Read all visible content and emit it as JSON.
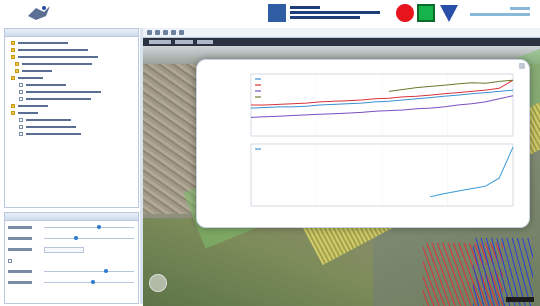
{
  "app": {
    "title": ""
  },
  "colors": {
    "alert": "#e8141d",
    "ok": "#16b34a",
    "info": "#2a4fa8",
    "accent": "#2f7dd2"
  },
  "banner": {
    "logo_icon": "satellite-logo-icon",
    "status_icons": [
      "red-circle-icon",
      "green-square-icon",
      "blue-triangle-down-icon"
    ]
  },
  "layers": {
    "header": "",
    "items": [
      {
        "type": "folder",
        "label": ""
      },
      {
        "type": "folder",
        "label": ""
      },
      {
        "type": "folder",
        "label": ""
      },
      {
        "type": "folder",
        "label": ""
      },
      {
        "type": "folder",
        "label": ""
      },
      {
        "type": "folder",
        "label": ""
      },
      {
        "type": "checkbox",
        "label": ""
      },
      {
        "type": "checkbox",
        "label": ""
      },
      {
        "type": "checkbox",
        "label": ""
      },
      {
        "type": "folder",
        "label": ""
      },
      {
        "type": "folder",
        "label": ""
      },
      {
        "type": "checkbox",
        "label": ""
      },
      {
        "type": "checkbox",
        "label": ""
      },
      {
        "type": "checkbox",
        "label": ""
      }
    ]
  },
  "properties": {
    "header": "",
    "rows": [
      {
        "kind": "slider",
        "label": "",
        "value": 0.62
      },
      {
        "kind": "slider",
        "label": "",
        "value": 0.35
      },
      {
        "kind": "select",
        "label": "",
        "value": ""
      },
      {
        "kind": "check",
        "label": ""
      },
      {
        "kind": "slider",
        "label": "",
        "value": 0.7
      },
      {
        "kind": "slider",
        "label": "",
        "value": 0.55
      }
    ]
  },
  "map": {
    "tabs": [
      "",
      "",
      ""
    ]
  },
  "chart_data": [
    {
      "type": "line",
      "title": "",
      "ylabel": "",
      "legend_position": "top-left",
      "grid": true,
      "series": [
        {
          "name": "",
          "color": "#3a8fd6",
          "y": [
            0.45,
            0.46,
            0.47,
            0.47,
            0.48,
            0.5,
            0.51,
            0.52,
            0.53,
            0.55,
            0.56,
            0.58,
            0.6,
            0.62,
            0.64,
            0.66,
            0.68,
            0.7,
            0.72,
            0.74
          ]
        },
        {
          "name": "",
          "color": "#d8333a",
          "y": [
            0.5,
            0.5,
            0.51,
            0.52,
            0.53,
            0.55,
            0.56,
            0.57,
            0.58,
            0.6,
            0.61,
            0.63,
            0.64,
            0.66,
            0.68,
            0.7,
            0.72,
            0.74,
            0.77,
            0.9
          ]
        },
        {
          "name": "",
          "color": "#7b4fc2",
          "y": [
            0.3,
            0.31,
            0.32,
            0.33,
            0.34,
            0.35,
            0.36,
            0.37,
            0.38,
            0.4,
            0.41,
            0.42,
            0.44,
            0.45,
            0.47,
            0.5,
            0.52,
            0.55,
            0.6,
            0.65
          ]
        },
        {
          "name": "",
          "color": "#6b7a2a",
          "y": [
            null,
            null,
            null,
            null,
            null,
            null,
            null,
            null,
            null,
            null,
            0.72,
            0.75,
            0.78,
            0.8,
            0.82,
            0.84,
            0.86,
            0.85,
            0.88,
            0.9
          ]
        }
      ]
    },
    {
      "type": "line",
      "title": "",
      "ylabel": "",
      "legend_position": "top-left",
      "grid": true,
      "series": [
        {
          "name": "",
          "color": "#3a9ad6",
          "y": [
            null,
            null,
            null,
            null,
            null,
            null,
            null,
            null,
            null,
            null,
            null,
            null,
            null,
            0.15,
            0.2,
            0.24,
            0.28,
            0.32,
            0.45,
            0.95
          ]
        }
      ]
    }
  ],
  "popup": {
    "footer_text": ""
  }
}
